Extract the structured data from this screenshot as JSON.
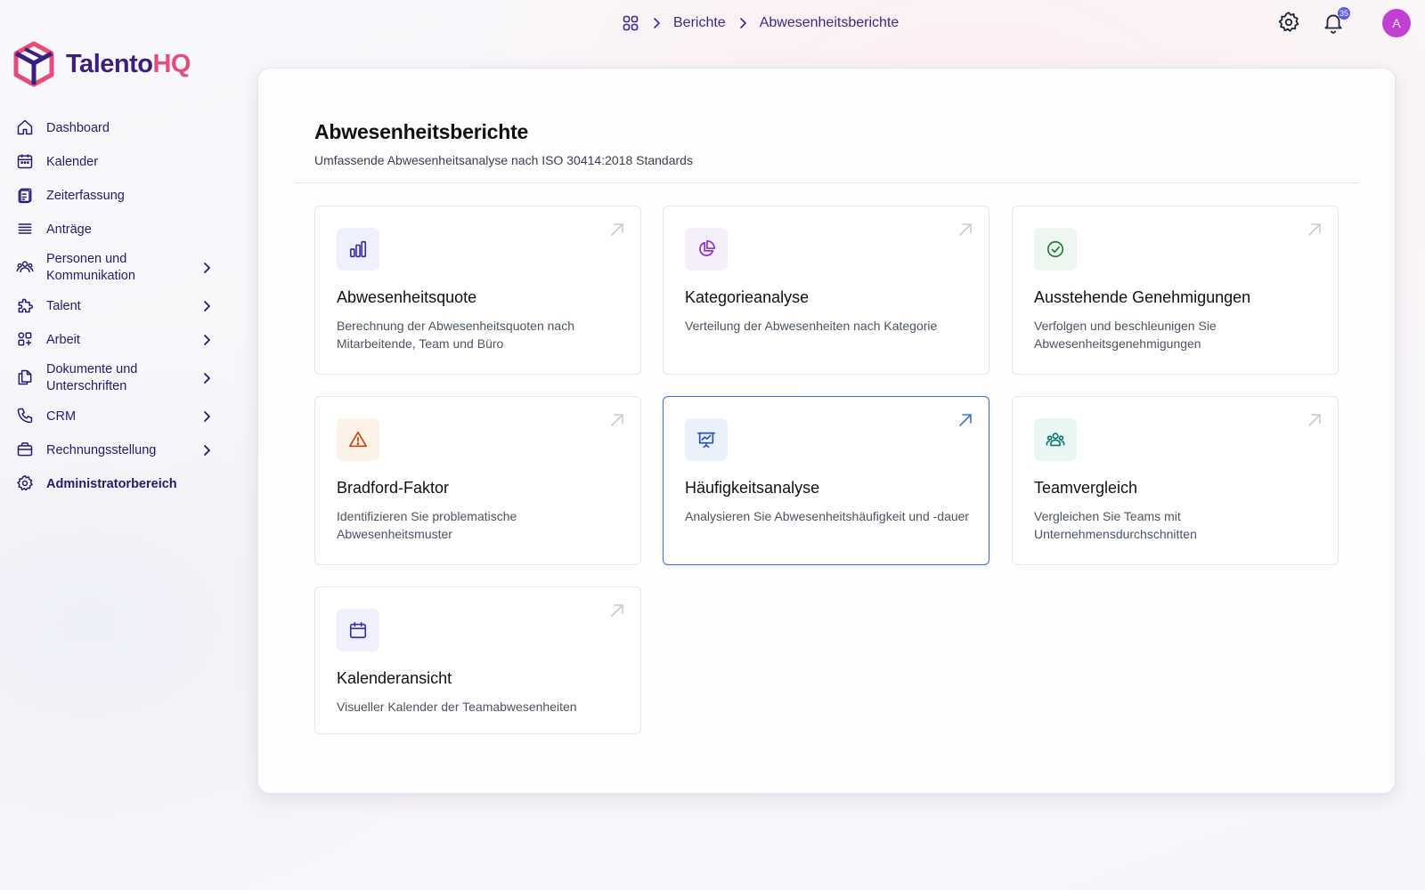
{
  "brand": {
    "name_part1": "Talento",
    "name_part2": "HQ",
    "color_primary": "#3b1f7a",
    "color_accent": "#e84a7a"
  },
  "sidebar": {
    "items": [
      {
        "label": "Dashboard",
        "icon": "home-icon",
        "has_chevron": false
      },
      {
        "label": "Kalender",
        "icon": "calendar-icon",
        "has_chevron": false
      },
      {
        "label": "Zeiterfassung",
        "icon": "clipboard-icon",
        "has_chevron": false
      },
      {
        "label": "Anträge",
        "icon": "list-icon",
        "has_chevron": false
      },
      {
        "label": "Personen und Kommunikation",
        "icon": "users-icon",
        "has_chevron": true
      },
      {
        "label": "Talent",
        "icon": "puzzle-icon",
        "has_chevron": true
      },
      {
        "label": "Arbeit",
        "icon": "apps-icon",
        "has_chevron": true
      },
      {
        "label": "Dokumente und Unterschriften",
        "icon": "documents-icon",
        "has_chevron": true
      },
      {
        "label": "CRM",
        "icon": "phone-icon",
        "has_chevron": true
      },
      {
        "label": "Rechnungsstellung",
        "icon": "briefcase-icon",
        "has_chevron": true
      },
      {
        "label": "Administratorbereich",
        "icon": "gear-icon",
        "has_chevron": false
      }
    ]
  },
  "topbar": {
    "breadcrumb": {
      "home_icon": "grid-icon",
      "items": [
        "Berichte",
        "Abwesenheitsberichte"
      ]
    },
    "notifications_count": "35",
    "avatar_initial": "A"
  },
  "page": {
    "title": "Abwesenheitsberichte",
    "subtitle": "Umfassende Abwesenheitsanalyse nach ISO 30414:2018 Standards"
  },
  "cards": [
    {
      "title": "Abwesenheitsquote",
      "description": "Berechnung der Abwesenheitsquoten nach Mitarbeitende, Team und Büro",
      "icon": "bar-chart-icon",
      "icon_bg": "#eef0fb",
      "icon_color": "#3b2fb0"
    },
    {
      "title": "Kategorieanalyse",
      "description": "Verteilung der Abwesenheiten nach Kategorie",
      "icon": "pie-chart-icon",
      "icon_bg": "#f6eefb",
      "icon_color": "#8a2fc4"
    },
    {
      "title": "Ausstehende Genehmigungen",
      "description": "Verfolgen und beschleunigen Sie Abwesenheitsgenehmigungen",
      "icon": "check-circle-icon",
      "icon_bg": "#ecf8ef",
      "icon_color": "#1f7a3f"
    },
    {
      "title": "Bradford-Faktor",
      "description": "Identifizieren Sie problematische Abwesenheitsmuster",
      "icon": "warning-icon",
      "icon_bg": "#fdf2e8",
      "icon_color": "#c2410c"
    },
    {
      "title": "Häufigkeitsanalyse",
      "description": "Analysieren Sie Abwesenheitshäufigkeit und -dauer",
      "icon": "presentation-chart-icon",
      "icon_bg": "#e9f1fc",
      "icon_color": "#2a4fb0"
    },
    {
      "title": "Teamvergleich",
      "description": "Vergleichen Sie Teams mit Unternehmensdurchschnitten",
      "icon": "team-icon",
      "icon_bg": "#e8f7f4",
      "icon_color": "#0f766e"
    },
    {
      "title": "Kalenderansicht",
      "description": "Visueller Kalender der Teamabwesenheiten",
      "icon": "calendar-icon",
      "icon_bg": "#eef0fb",
      "icon_color": "#3b2fb0"
    }
  ],
  "active_card": "Häufigkeitsanalyse",
  "colors": {
    "nav_text": "#2a1a6e",
    "active_border": "#3f73d9",
    "badge": "#5b5be8",
    "avatar": "#c23fd6"
  }
}
